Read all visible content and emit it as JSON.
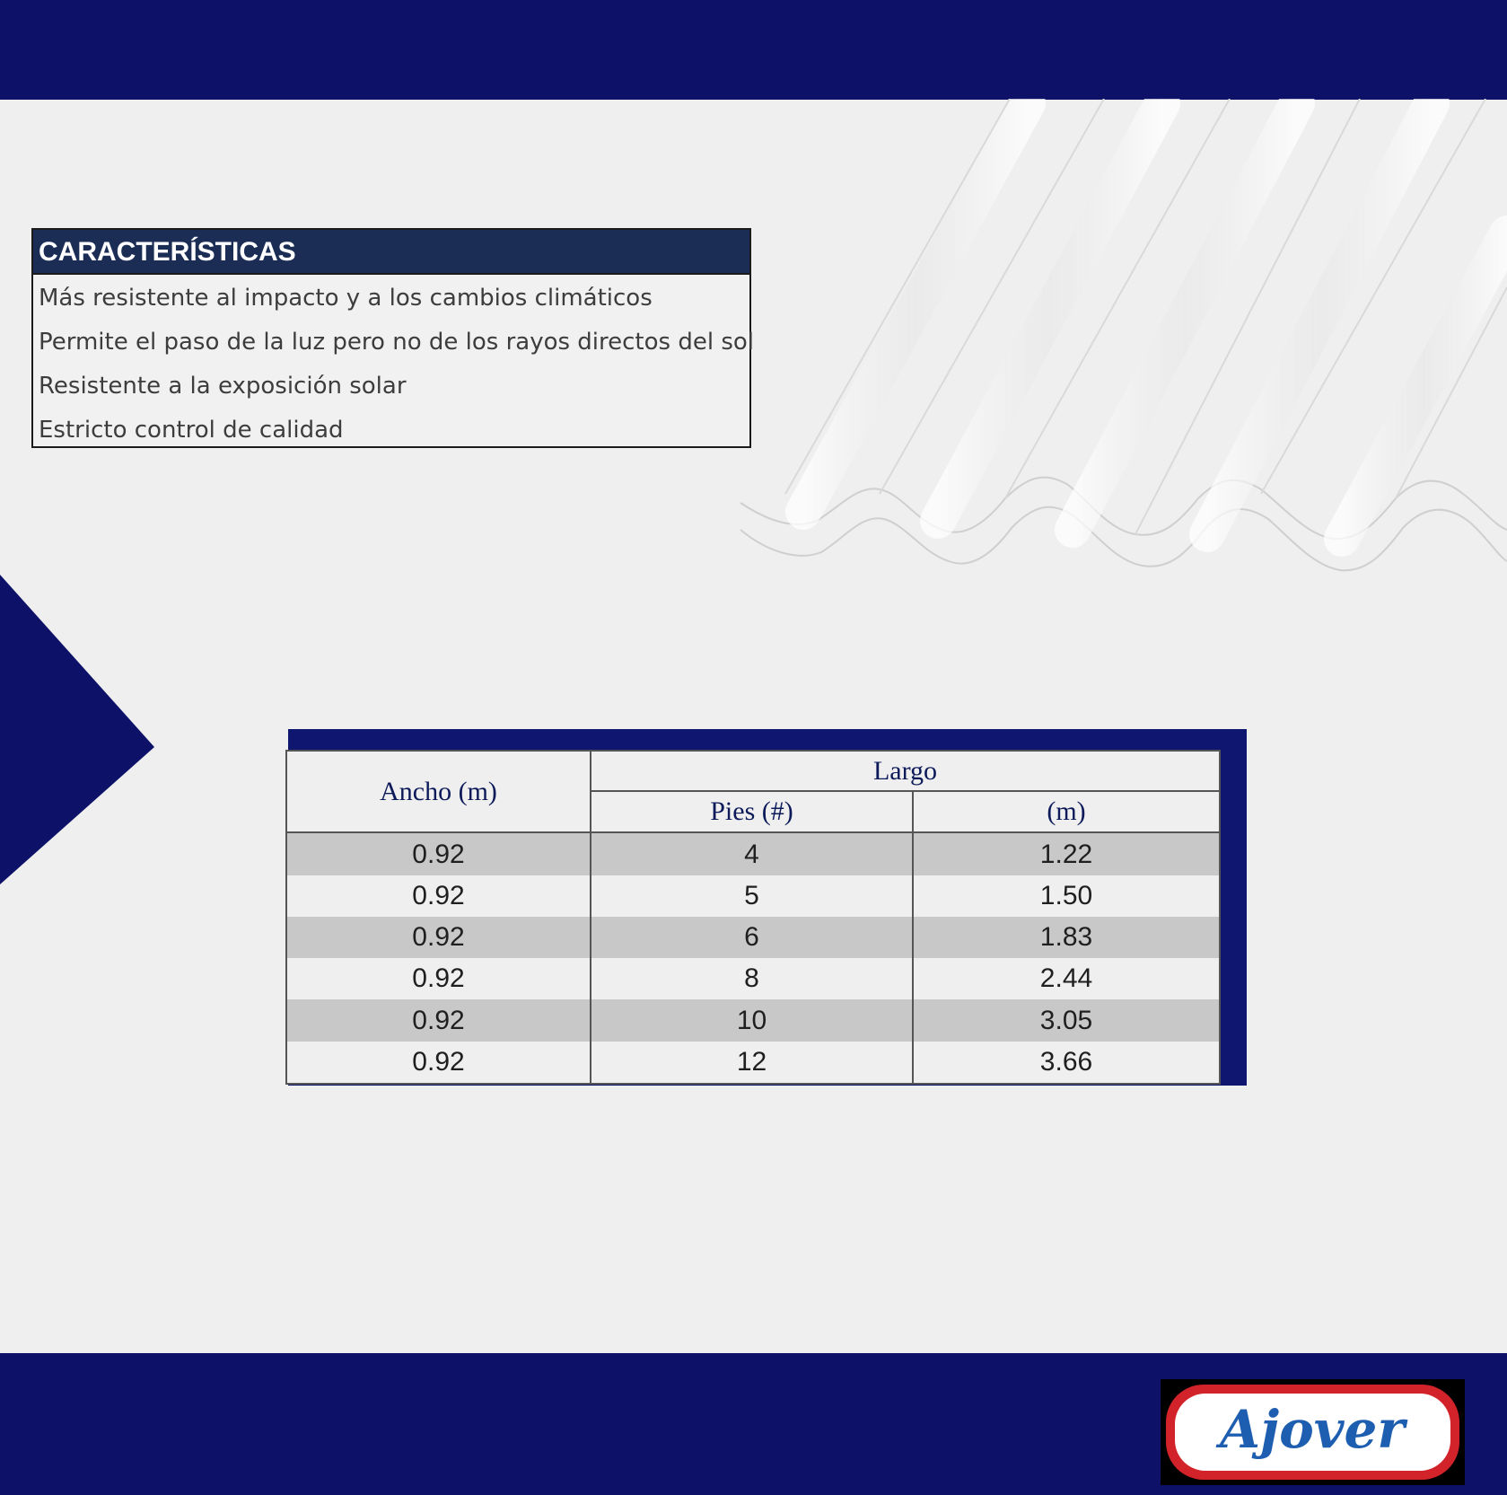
{
  "features": {
    "title": "CARACTERÍSTICAS",
    "items": [
      "Más resistente al impacto y a los cambios climáticos",
      "Permite el paso de la luz pero no de los rayos directos del sol",
      "Resistente a la exposición solar",
      "Estricto control de calidad"
    ]
  },
  "table": {
    "ancho_header": "Ancho (m)",
    "largo_header": "Largo",
    "pies_header": "Pies (#)",
    "m_header": "(m)",
    "rows": [
      [
        "0.92",
        "4",
        "1.22"
      ],
      [
        "0.92",
        "5",
        "1.50"
      ],
      [
        "0.92",
        "6",
        "1.83"
      ],
      [
        "0.92",
        "8",
        "2.44"
      ],
      [
        "0.92",
        "10",
        "3.05"
      ],
      [
        "0.92",
        "12",
        "3.66"
      ]
    ]
  },
  "brand": {
    "logo_text": "Ajover",
    "primary_color": "#0d1268",
    "logo_blue": "#1e5eb0",
    "logo_red": "#d2232a"
  }
}
